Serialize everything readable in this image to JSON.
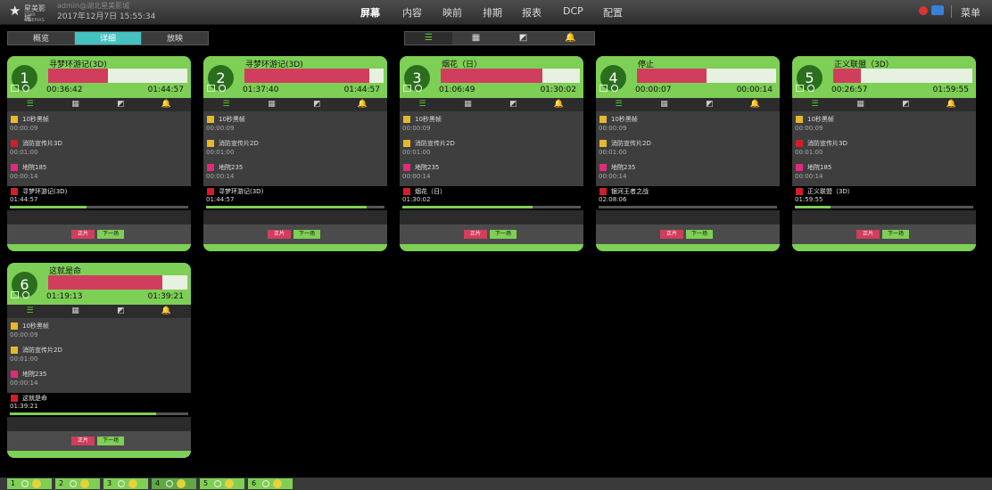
{
  "header": {
    "brand": "星美影城",
    "brand_sub": "STAR CINEMAS",
    "user": "admin@湖北星美影城",
    "datetime": "2017年12月7日 15:55:34",
    "nav": [
      "屏幕",
      "内容",
      "映前",
      "排期",
      "报表",
      "DCP",
      "配置"
    ],
    "menu": "菜单",
    "brand_colors": {
      "nav_active": "#ffffff",
      "accent_green": "#7dcf55",
      "accent_pink": "#d13d5c",
      "accent_teal": "#45c1bf"
    }
  },
  "view_tabs": [
    "概览",
    "详细",
    "放映"
  ],
  "view_tab_active": "详细",
  "icon_tabs": [
    "list-icon",
    "grid-icon",
    "export-icon",
    "bell-icon"
  ],
  "icon_glyphs": [
    "☰",
    "▦",
    "◩",
    "🔔"
  ],
  "buttons": {
    "feature": "正片",
    "next": "下一场"
  },
  "screens": [
    {
      "number": "1",
      "title": "寻梦环游记(3D)",
      "progress": 0.43,
      "elapsed": "00:36:42",
      "total": "01:44:57",
      "items": [
        {
          "name": "10秒黑帧",
          "duration": "00:00:09",
          "color": "#e6b82c"
        },
        {
          "name": "消防宣传片3D",
          "duration": "00:01:00",
          "color": "#d11e2a"
        },
        {
          "name": "地院185",
          "duration": "00:00:14",
          "color": "#e22a7a"
        }
      ],
      "current": {
        "name": "寻梦环游记(3D)",
        "duration": "01:44:57",
        "color": "#d11e2a",
        "progress": 0.43
      }
    },
    {
      "number": "2",
      "title": "寻梦环游记(3D)",
      "progress": 0.9,
      "elapsed": "01:37:40",
      "total": "01:44:57",
      "items": [
        {
          "name": "10秒黑帧",
          "duration": "00:00:09",
          "color": "#e6b82c"
        },
        {
          "name": "消防宣传片2D",
          "duration": "00:01:00",
          "color": "#e6b82c"
        },
        {
          "name": "地院235",
          "duration": "00:00:14",
          "color": "#e22a7a"
        }
      ],
      "current": {
        "name": "寻梦环游记(3D)",
        "duration": "01:44:57",
        "color": "#d11e2a",
        "progress": 0.9
      }
    },
    {
      "number": "3",
      "title": "烟花（日）",
      "progress": 0.73,
      "elapsed": "01:06:49",
      "total": "01:30:02",
      "items": [
        {
          "name": "10秒黑帧",
          "duration": "00:00:09",
          "color": "#e6b82c"
        },
        {
          "name": "消防宣传片2D",
          "duration": "00:01:00",
          "color": "#e6b82c"
        },
        {
          "name": "地院235",
          "duration": "00:00:14",
          "color": "#e22a7a"
        }
      ],
      "current": {
        "name": "烟花（日）",
        "duration": "01:30:02",
        "color": "#d11e2a",
        "progress": 0.73
      }
    },
    {
      "number": "4",
      "title": "停止",
      "progress": 0.5,
      "elapsed": "00:00:07",
      "total": "00:00:14",
      "items": [
        {
          "name": "10秒黑帧",
          "duration": "00:00:09",
          "color": "#e6b82c"
        },
        {
          "name": "消防宣传片2D",
          "duration": "00:01:00",
          "color": "#e6b82c"
        },
        {
          "name": "地院235",
          "duration": "00:00:14",
          "color": "#e22a7a"
        }
      ],
      "current": {
        "name": "银河王者之战",
        "duration": "02:08:06",
        "color": "#d11e2a",
        "progress": 0
      }
    },
    {
      "number": "5",
      "title": "正义联盟（3D）",
      "progress": 0.2,
      "elapsed": "00:26:57",
      "total": "01:59:55",
      "items": [
        {
          "name": "10秒黑帧",
          "duration": "00:00:09",
          "color": "#e6b82c"
        },
        {
          "name": "消防宣传片3D",
          "duration": "00:01:00",
          "color": "#d11e2a"
        },
        {
          "name": "地院185",
          "duration": "00:00:14",
          "color": "#e22a7a"
        }
      ],
      "current": {
        "name": "正义联盟（3D）",
        "duration": "01:59:55",
        "color": "#d11e2a",
        "progress": 0.2
      }
    },
    {
      "number": "6",
      "title": "这就是命",
      "progress": 0.82,
      "elapsed": "01:19:13",
      "total": "01:39:21",
      "items": [
        {
          "name": "10秒黑帧",
          "duration": "00:00:09",
          "color": "#e6b82c"
        },
        {
          "name": "消防宣传片2D",
          "duration": "00:01:00",
          "color": "#e6b82c"
        },
        {
          "name": "地院235",
          "duration": "00:00:14",
          "color": "#e22a7a"
        }
      ],
      "current": {
        "name": "这就是命",
        "duration": "01:39:21",
        "color": "#d11e2a",
        "progress": 0.82
      }
    }
  ],
  "bottom_tabs": [
    "1",
    "2",
    "3",
    "4",
    "5",
    "6"
  ],
  "bottom_tab_active": "4"
}
